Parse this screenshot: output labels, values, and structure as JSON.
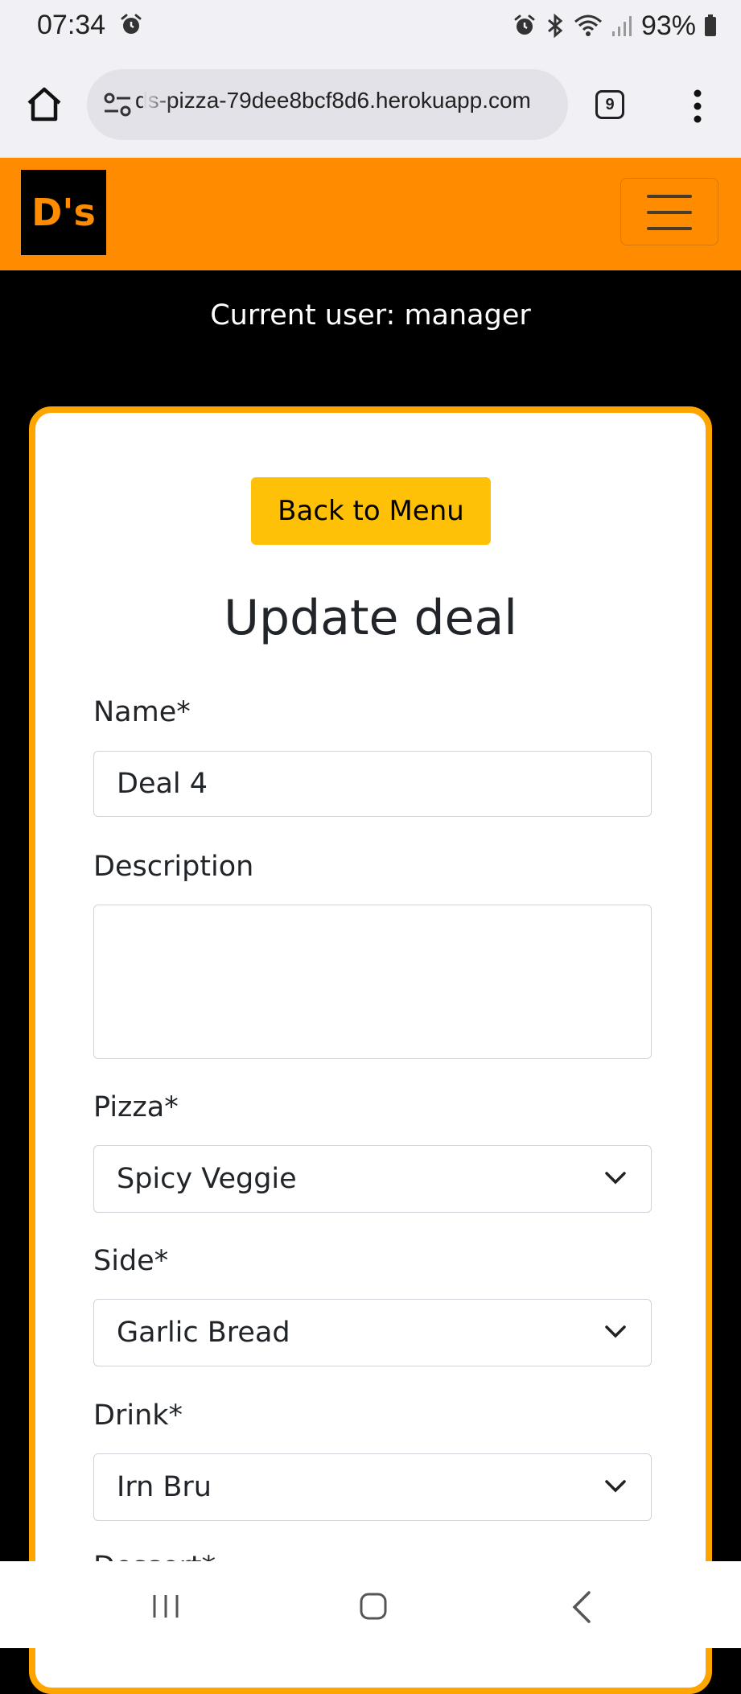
{
  "status_bar": {
    "time": "07:34",
    "battery": "93%"
  },
  "browser": {
    "url": "ds-pizza-79dee8bcf8d6.herokuapp.com",
    "tab_count": "9"
  },
  "navbar": {
    "brand": "D's",
    "brand_color": "#ff8c00"
  },
  "current_user": "Current user: manager",
  "form": {
    "back_button": "Back to Menu",
    "title": "Update deal",
    "name_label": "Name*",
    "name_value": "Deal 4",
    "description_label": "Description",
    "description_value": "",
    "pizza_label": "Pizza*",
    "pizza_value": "Spicy Veggie",
    "side_label": "Side*",
    "side_value": "Garlic Bread",
    "drink_label": "Drink*",
    "drink_value": "Irn Bru",
    "dessert_label": "Dessert*"
  },
  "colors": {
    "accent_orange": "#ff8c00",
    "card_border": "#ffa500",
    "button_yellow": "#ffc107"
  }
}
